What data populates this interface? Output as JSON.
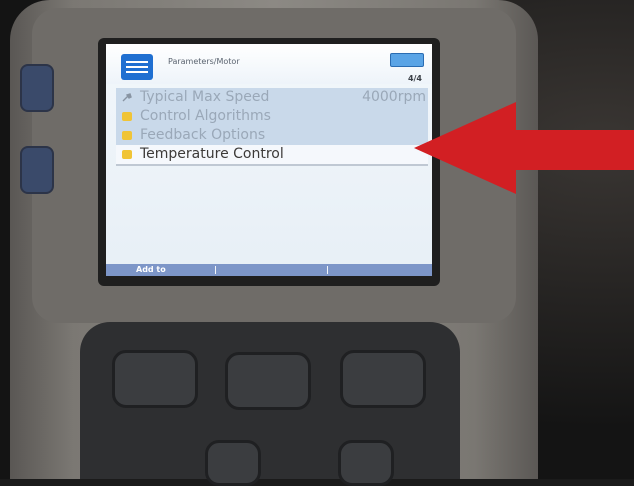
{
  "screen": {
    "breadcrumb": "Parameters/Motor",
    "page_indicator": "4/4",
    "softkey_left": "Add to",
    "softkey_mid1": "|",
    "softkey_mid2": "|",
    "items": [
      {
        "label": "Typical Max Speed",
        "value": "4000rpm",
        "icon": "wrench-icon",
        "selected": false
      },
      {
        "label": "Control Algorithms",
        "value": "",
        "icon": "folder-icon",
        "selected": false
      },
      {
        "label": "Feedback Options",
        "value": "",
        "icon": "folder-icon",
        "selected": false
      },
      {
        "label": "Temperature Control",
        "value": "",
        "icon": "folder-icon",
        "selected": true
      }
    ]
  },
  "colors": {
    "arrow": "#d21f23",
    "selection": "#f5f8fc",
    "row_highlight": "#c9d9ea",
    "softkey_bar": "#7d96c8"
  }
}
